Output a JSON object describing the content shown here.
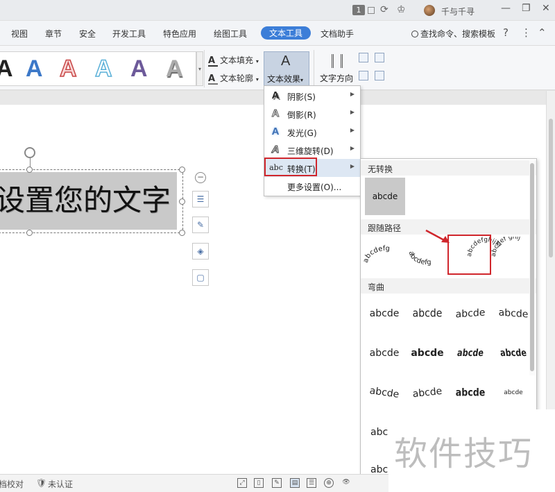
{
  "titlebar": {
    "page_count": "1",
    "user_name": "千与千寻"
  },
  "menu": {
    "items": [
      "视图",
      "章节",
      "安全",
      "开发工具",
      "特色应用",
      "绘图工具",
      "文本工具",
      "文档助手"
    ],
    "active": "文本工具",
    "search_label": "查找命令、搜索模板"
  },
  "ribbon": {
    "text_fill": "文本填充",
    "text_outline": "文本轮廓",
    "text_effect": "文本效果",
    "text_direction": "文字方向"
  },
  "document": {
    "text": "设置您的文字"
  },
  "effect_menu": {
    "items": [
      {
        "label": "阴影(S)",
        "icon": "shadow-icon"
      },
      {
        "label": "倒影(R)",
        "icon": "reflection-icon"
      },
      {
        "label": "发光(G)",
        "icon": "glow-icon"
      },
      {
        "label": "三维旋转(D)",
        "icon": "3d-rotation-icon"
      },
      {
        "label": "转换(T)",
        "icon": "transform-icon",
        "icon_text": "abc"
      },
      {
        "label": "更多设置(O)..."
      }
    ]
  },
  "transform_panel": {
    "section_none": "无转换",
    "none_sample": "abcde",
    "section_path": "跟随路径",
    "section_warp": "弯曲",
    "path_samples": [
      "abcdefg",
      "abcdefg",
      "abcdefghijkl",
      "abcdef ghij"
    ],
    "warp_rows": [
      [
        "abcde",
        "abcde",
        "abcde",
        "abcde"
      ],
      [
        "abcde",
        "abcde",
        "abcde",
        "abcde"
      ],
      [
        "abcde",
        "abcde",
        "abcde",
        "abcde"
      ],
      [
        "abc"
      ],
      [
        "abc"
      ]
    ]
  },
  "statusbar": {
    "proofread": "档校对",
    "certify": "未认证"
  },
  "watermark": "软件技巧",
  "colors": {
    "accent": "#3c7ed8",
    "highlight_red": "#d0262c"
  }
}
